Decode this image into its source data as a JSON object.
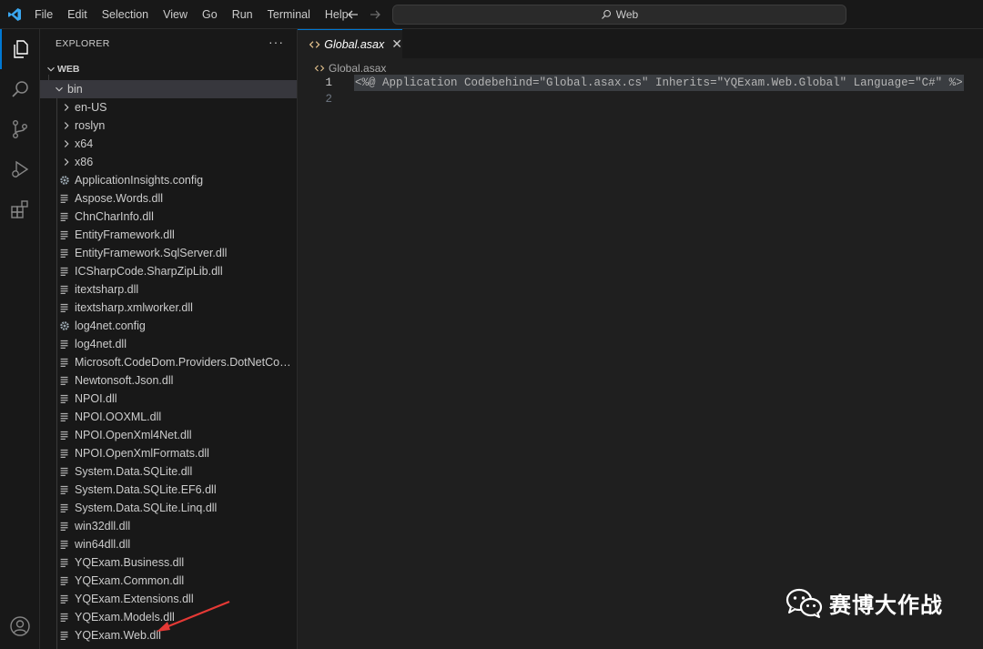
{
  "titlebar": {
    "menus": [
      "File",
      "Edit",
      "Selection",
      "View",
      "Go",
      "Run",
      "Terminal",
      "Help"
    ],
    "search_label": "Web",
    "icons": [
      "vscode-logo-icon",
      "arrow-left-icon",
      "arrow-right-icon",
      "search-icon"
    ]
  },
  "activitybar": {
    "items": [
      "explorer-icon",
      "search-icon",
      "source-control-icon",
      "run-debug-icon",
      "extensions-icon"
    ],
    "bottom": [
      "account-icon"
    ]
  },
  "sidebar": {
    "title": "EXPLORER",
    "more": "···",
    "section": "WEB",
    "folder": "bin",
    "subfolders": [
      "en-US",
      "roslyn",
      "x64",
      "x86"
    ],
    "files": [
      {
        "name": "ApplicationInsights.config",
        "icon": "gear-icon"
      },
      {
        "name": "Aspose.Words.dll",
        "icon": "file-lines-icon"
      },
      {
        "name": "ChnCharInfo.dll",
        "icon": "file-lines-icon"
      },
      {
        "name": "EntityFramework.dll",
        "icon": "file-lines-icon"
      },
      {
        "name": "EntityFramework.SqlServer.dll",
        "icon": "file-lines-icon"
      },
      {
        "name": "ICSharpCode.SharpZipLib.dll",
        "icon": "file-lines-icon"
      },
      {
        "name": "itextsharp.dll",
        "icon": "file-lines-icon"
      },
      {
        "name": "itextsharp.xmlworker.dll",
        "icon": "file-lines-icon"
      },
      {
        "name": "log4net.config",
        "icon": "gear-icon"
      },
      {
        "name": "log4net.dll",
        "icon": "file-lines-icon"
      },
      {
        "name": "Microsoft.CodeDom.Providers.DotNetCompil...",
        "icon": "file-lines-icon"
      },
      {
        "name": "Newtonsoft.Json.dll",
        "icon": "file-lines-icon"
      },
      {
        "name": "NPOI.dll",
        "icon": "file-lines-icon"
      },
      {
        "name": "NPOI.OOXML.dll",
        "icon": "file-lines-icon"
      },
      {
        "name": "NPOI.OpenXml4Net.dll",
        "icon": "file-lines-icon"
      },
      {
        "name": "NPOI.OpenXmlFormats.dll",
        "icon": "file-lines-icon"
      },
      {
        "name": "System.Data.SQLite.dll",
        "icon": "file-lines-icon"
      },
      {
        "name": "System.Data.SQLite.EF6.dll",
        "icon": "file-lines-icon"
      },
      {
        "name": "System.Data.SQLite.Linq.dll",
        "icon": "file-lines-icon"
      },
      {
        "name": "win32dll.dll",
        "icon": "file-lines-icon"
      },
      {
        "name": "win64dll.dll",
        "icon": "file-lines-icon"
      },
      {
        "name": "YQExam.Business.dll",
        "icon": "file-lines-icon"
      },
      {
        "name": "YQExam.Common.dll",
        "icon": "file-lines-icon"
      },
      {
        "name": "YQExam.Extensions.dll",
        "icon": "file-lines-icon"
      },
      {
        "name": "YQExam.Models.dll",
        "icon": "file-lines-icon"
      },
      {
        "name": "YQExam.Web.dll",
        "icon": "file-lines-icon"
      }
    ]
  },
  "editor": {
    "tab_label": "Global.asax",
    "tab_close": "✕",
    "breadcrumb": "Global.asax",
    "lines": [
      {
        "number": "1",
        "text": "<%@ Application Codebehind=\"Global.asax.cs\" Inherits=\"YQExam.Web.Global\" Language=\"C#\" %>"
      },
      {
        "number": "2",
        "text": ""
      }
    ]
  },
  "colors": {
    "accent": "#0078d4",
    "tab_icon": "#e2c08d",
    "arrow": "#e53935"
  },
  "watermark": {
    "text": "赛博大作战",
    "icon": "wechat-icon"
  }
}
